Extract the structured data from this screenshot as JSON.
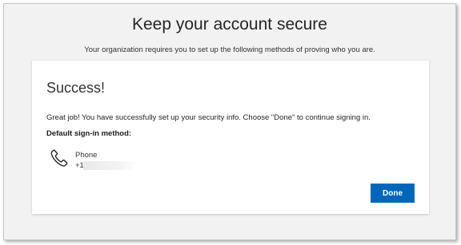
{
  "page": {
    "title": "Keep your account secure",
    "subtitle": "Your organization requires you to set up the following methods of proving who you are."
  },
  "card": {
    "heading": "Success!",
    "message": "Great job! You have successfully set up your security info. Choose \"Done\" to continue signing in.",
    "default_method_label": "Default sign-in method:",
    "method": {
      "icon": "phone-icon",
      "name": "Phone",
      "value": "+1"
    },
    "done_label": "Done"
  },
  "colors": {
    "accent": "#0067b8",
    "background": "#f2f2f2",
    "card": "#ffffff"
  }
}
